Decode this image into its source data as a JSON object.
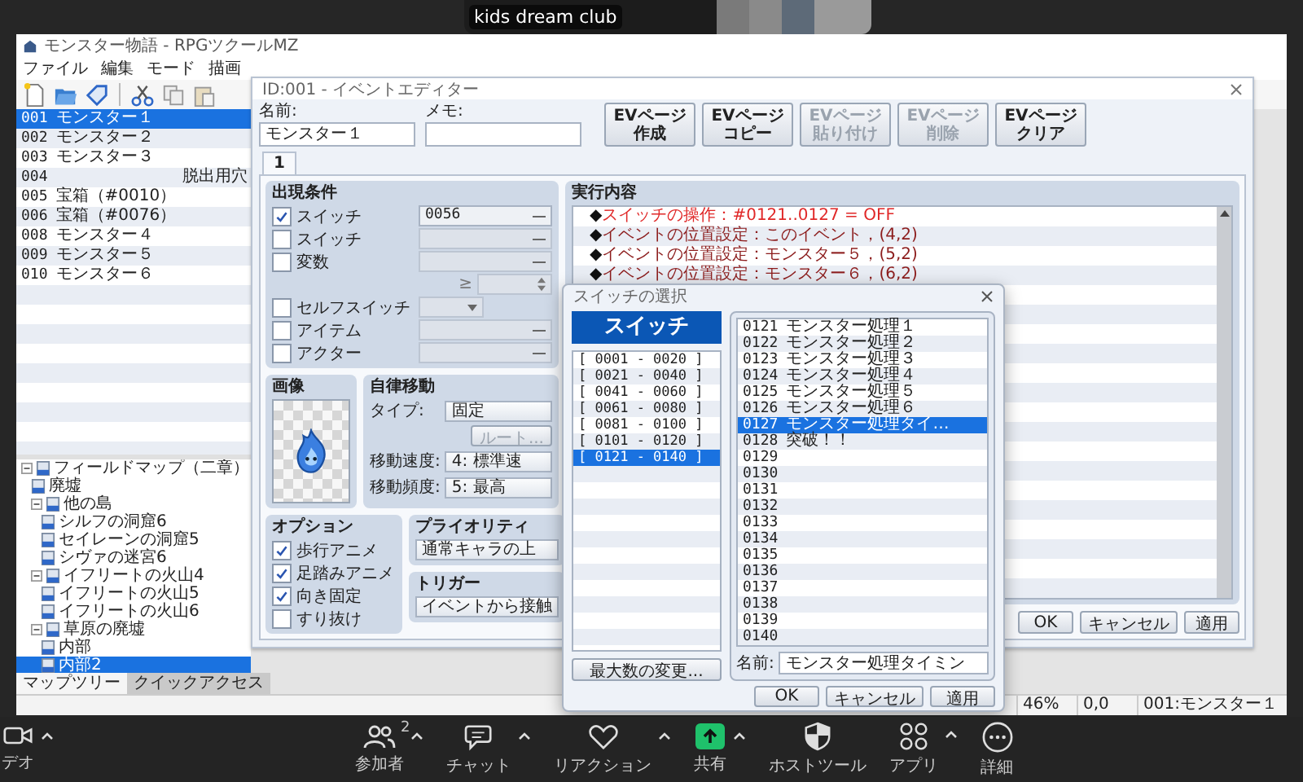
{
  "video": {
    "label": "kids dream club"
  },
  "app": {
    "title": "モンスター物語 - RPGツクールMZ",
    "menu": [
      "ファイル",
      "編集",
      "モード",
      "描画"
    ],
    "events": [
      {
        "number": "001",
        "name": "モンスター１",
        "selected": true
      },
      {
        "number": "002",
        "name": "モンスター２",
        "selected": false
      },
      {
        "number": "003",
        "name": "モンスター３",
        "selected": false
      },
      {
        "number": "004",
        "tail": "脱出用穴",
        "selected": false
      },
      {
        "number": "005",
        "name": "宝箱（#0010）",
        "selected": false
      },
      {
        "number": "006",
        "name": "宝箱（#0076）",
        "selected": false
      },
      {
        "number": "008",
        "name": "モンスター４",
        "selected": false
      },
      {
        "number": "009",
        "name": "モンスター５",
        "selected": false
      },
      {
        "number": "010",
        "name": "モンスター６",
        "selected": false
      }
    ],
    "map_tree": [
      {
        "name": "フィールドマップ（二章）",
        "expanded": true,
        "selected": false,
        "children": [
          {
            "name": "廃墟",
            "selected": false
          },
          {
            "name": "他の島",
            "expanded": true,
            "selected": false,
            "children": [
              {
                "name": "シルフの洞窟6",
                "selected": false
              },
              {
                "name": "セイレーンの洞窟5",
                "selected": false
              },
              {
                "name": "シヴァの迷宮6",
                "selected": false
              }
            ]
          },
          {
            "name": "イフリートの火山4",
            "expanded": true,
            "selected": false,
            "children": [
              {
                "name": "イフリートの火山5",
                "selected": false
              },
              {
                "name": "イフリートの火山6",
                "selected": false
              }
            ]
          },
          {
            "name": "草原の廃墟",
            "expanded": true,
            "selected": false,
            "children": [
              {
                "name": "内部",
                "selected": false
              },
              {
                "name": "内部2",
                "selected": true
              }
            ]
          }
        ]
      }
    ],
    "pane_tabs": [
      {
        "label": "マップツリー",
        "selected": true
      },
      {
        "label": "クイックアクセス",
        "selected": false
      }
    ],
    "status": [
      "46%",
      "0,0",
      "001:モンスター１"
    ]
  },
  "editor": {
    "title": "ID:001 - イベントエディター",
    "name_label": "名前:",
    "name_value": "モンスター１",
    "memo_label": "メモ:",
    "page_buttons": [
      {
        "label": "EVページ作成",
        "disabled": false
      },
      {
        "label": "EVページコピー",
        "disabled": false
      },
      {
        "label": "EVページ貼り付け",
        "disabled": true
      },
      {
        "label": "EVページ削除",
        "disabled": true
      },
      {
        "label": "EVページクリア",
        "disabled": false
      }
    ],
    "page_tabs": [
      {
        "label": "1",
        "selected": true
      }
    ],
    "conditions": {
      "title": "出現条件",
      "rows": [
        {
          "kind": "switch",
          "label": "スイッチ",
          "checked": true,
          "value": "0056"
        },
        {
          "kind": "switch",
          "label": "スイッチ",
          "checked": false
        },
        {
          "kind": "variable",
          "label": "変数",
          "checked": false,
          "operator": "≥"
        },
        {
          "kind": "self_switch",
          "label": "セルフスイッチ",
          "checked": false
        },
        {
          "kind": "item",
          "label": "アイテム",
          "checked": false
        },
        {
          "kind": "actor",
          "label": "アクター",
          "checked": false
        }
      ]
    },
    "image": {
      "title": "画像"
    },
    "movement": {
      "title": "自律移動",
      "type_label": "タイプ:",
      "type_value": "固定",
      "route_button": "ルート...",
      "route_disabled": true,
      "speed_label": "移動速度:",
      "speed_value": "4: 標準速",
      "freq_label": "移動頻度:",
      "freq_value": "5: 最高"
    },
    "options": {
      "title": "オプション",
      "items": [
        {
          "label": "歩行アニメ",
          "checked": true
        },
        {
          "label": "足踏みアニメ",
          "checked": true
        },
        {
          "label": "向き固定",
          "checked": true
        },
        {
          "label": "すり抜け",
          "checked": false
        }
      ]
    },
    "priority": {
      "title": "プライオリティ",
      "value": "通常キャラの上"
    },
    "trigger": {
      "title": "トリガー",
      "value": "イベントから接触"
    },
    "contents": {
      "title": "実行内容",
      "lines": [
        {
          "kind": "switch_op",
          "bullet": "◆",
          "text": "スイッチの操作：#0121..0127 = OFF"
        },
        {
          "kind": "event_location",
          "bullet": "◆",
          "text": "イベントの位置設定：このイベント，(4,2)"
        },
        {
          "kind": "event_location",
          "bullet": "◆",
          "text": "イベントの位置設定：モンスター５，(5,2)"
        },
        {
          "kind": "event_location",
          "bullet": "◆",
          "text": "イベントの位置設定：モンスター６，(6,2)"
        }
      ]
    },
    "buttons": [
      "OK",
      "キャンセル",
      "適用"
    ]
  },
  "switch_dialog": {
    "title": "スイッチの選択",
    "header": "スイッチ",
    "groups": [
      {
        "label": "[ 0001 - 0020 ]",
        "selected": false
      },
      {
        "label": "[ 0021 - 0040 ]",
        "selected": false
      },
      {
        "label": "[ 0041 - 0060 ]",
        "selected": false
      },
      {
        "label": "[ 0061 - 0080 ]",
        "selected": false
      },
      {
        "label": "[ 0081 - 0100 ]",
        "selected": false
      },
      {
        "label": "[ 0101 - 0120 ]",
        "selected": false
      },
      {
        "label": "[ 0121 - 0140 ]",
        "selected": true
      }
    ],
    "max_button": "最大数の変更...",
    "items": [
      {
        "id": "0121",
        "name": "モンスター処理１",
        "selected": false
      },
      {
        "id": "0122",
        "name": "モンスター処理２",
        "selected": false
      },
      {
        "id": "0123",
        "name": "モンスター処理３",
        "selected": false
      },
      {
        "id": "0124",
        "name": "モンスター処理４",
        "selected": false
      },
      {
        "id": "0125",
        "name": "モンスター処理５",
        "selected": false
      },
      {
        "id": "0126",
        "name": "モンスター処理６",
        "selected": false
      },
      {
        "id": "0127",
        "name": "モンスター処理タイ…",
        "selected": true
      },
      {
        "id": "0128",
        "name": "突破！！",
        "selected": false
      },
      {
        "id": "0129",
        "selected": false
      },
      {
        "id": "0130",
        "selected": false
      },
      {
        "id": "0131",
        "selected": false
      },
      {
        "id": "0132",
        "selected": false
      },
      {
        "id": "0133",
        "selected": false
      },
      {
        "id": "0134",
        "selected": false
      },
      {
        "id": "0135",
        "selected": false
      },
      {
        "id": "0136",
        "selected": false
      },
      {
        "id": "0137",
        "selected": false
      },
      {
        "id": "0138",
        "selected": false
      },
      {
        "id": "0139",
        "selected": false
      },
      {
        "id": "0140",
        "selected": false
      }
    ],
    "name_label": "名前:",
    "name_value": "モンスター処理タイミン",
    "buttons": [
      "OK",
      "キャンセル",
      "適用"
    ]
  },
  "meeting_toolbar": [
    {
      "kind": "video",
      "label": "デオ",
      "has_menu": true
    },
    {
      "kind": "participants",
      "label": "参加者",
      "badge": "2",
      "has_menu": true
    },
    {
      "kind": "chat",
      "label": "チャット",
      "has_menu": true
    },
    {
      "kind": "reactions",
      "label": "リアクション",
      "has_menu": true
    },
    {
      "kind": "share",
      "label": "共有",
      "has_menu": true
    },
    {
      "kind": "host_tools",
      "label": "ホストツール",
      "has_menu": false
    },
    {
      "kind": "apps",
      "label": "アプリ",
      "has_menu": true
    },
    {
      "kind": "more",
      "label": "詳細",
      "has_menu": false
    }
  ]
}
